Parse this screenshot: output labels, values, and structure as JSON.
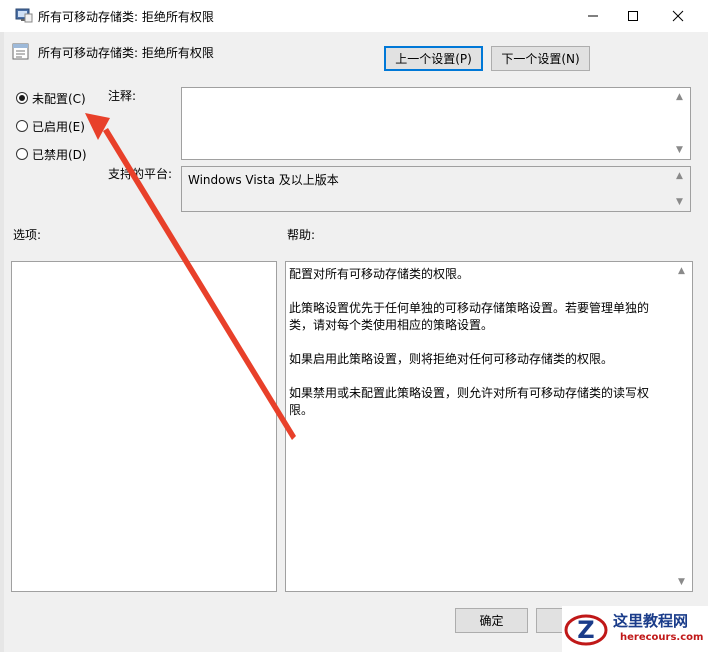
{
  "window": {
    "title": "所有可移动存储类: 拒绝所有权限"
  },
  "header": {
    "policy_title": "所有可移动存储类: 拒绝所有权限",
    "prev_button": "上一个设置(P)",
    "next_button": "下一个设置(N)"
  },
  "state": {
    "options": [
      {
        "label": "未配置(C)",
        "checked": true
      },
      {
        "label": "已启用(E)",
        "checked": false
      },
      {
        "label": "已禁用(D)",
        "checked": false
      }
    ]
  },
  "fields": {
    "comment_label": "注释:",
    "comment_value": "",
    "platform_label": "支持的平台:",
    "platform_value": "Windows Vista 及以上版本"
  },
  "panels": {
    "options_label": "选项:",
    "help_label": "帮助:",
    "help_paragraphs": [
      "配置对所有可移动存储类的权限。",
      "此策略设置优先于任何单独的可移动存储策略设置。若要管理单独的类，请对每个类使用相应的策略设置。",
      "如果启用此策略设置，则将拒绝对任何可移动存储类的权限。",
      "如果禁用或未配置此策略设置，则允许对所有可移动存储类的读写权限。"
    ]
  },
  "footer": {
    "ok_button": "确定",
    "cancel_button": ""
  },
  "watermark": {
    "text": "这里教程网",
    "sub": "herecours.com"
  },
  "annotation": {
    "arrow_color": "#e8402a"
  }
}
